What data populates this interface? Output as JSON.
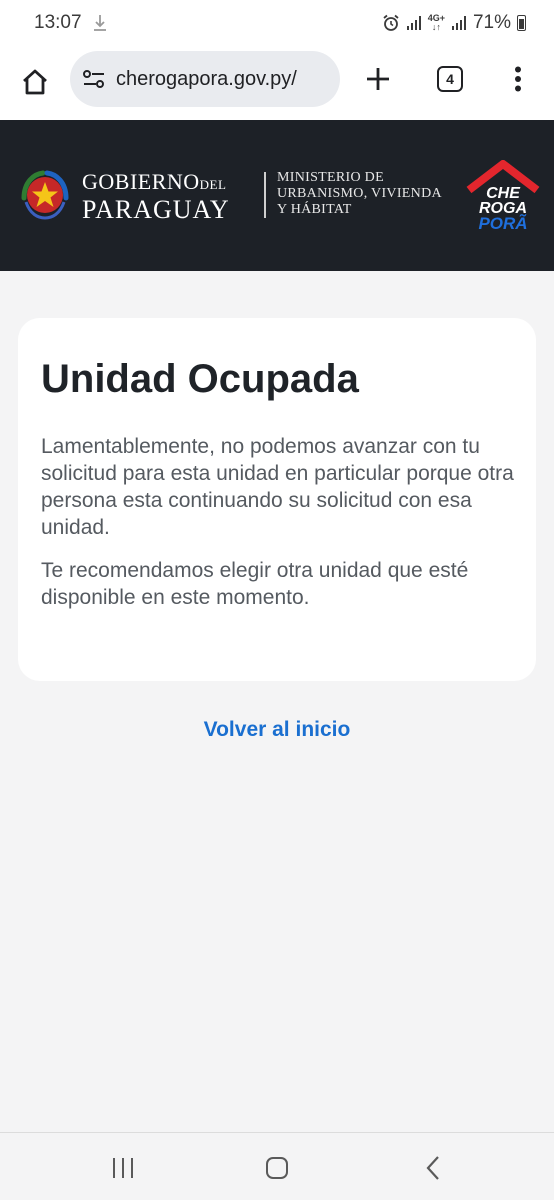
{
  "status_bar": {
    "time": "13:07",
    "network": "4G+",
    "battery": "71%"
  },
  "browser": {
    "url": "cherogapora.gov.py/",
    "tab_count": "4"
  },
  "header": {
    "gov_line1_main": "GOBIERNO",
    "gov_line1_small": "DEL",
    "gov_line2": "PARAGUAY",
    "ministry_line1": "MINISTERIO DE",
    "ministry_line2": "URBANISMO, VIVIENDA",
    "ministry_line3": "Y HÁBITAT",
    "logo_che": "CHE",
    "logo_roga": "ROGA",
    "logo_pora": "PORÃ"
  },
  "card": {
    "title": "Unidad Ocupada",
    "paragraph1": "Lamentablemente, no podemos avanzar con tu solicitud para esta unidad en particular porque otra persona esta continuando su solicitud con esa unidad.",
    "paragraph2": "Te recomendamos elegir otra unidad que esté disponible en este momento."
  },
  "back_link": "Volver al inicio",
  "colors": {
    "header_bg": "#1d2127",
    "link": "#1a6fd0",
    "logo_red": "#e3262d",
    "logo_blue": "#1f6fdc"
  }
}
